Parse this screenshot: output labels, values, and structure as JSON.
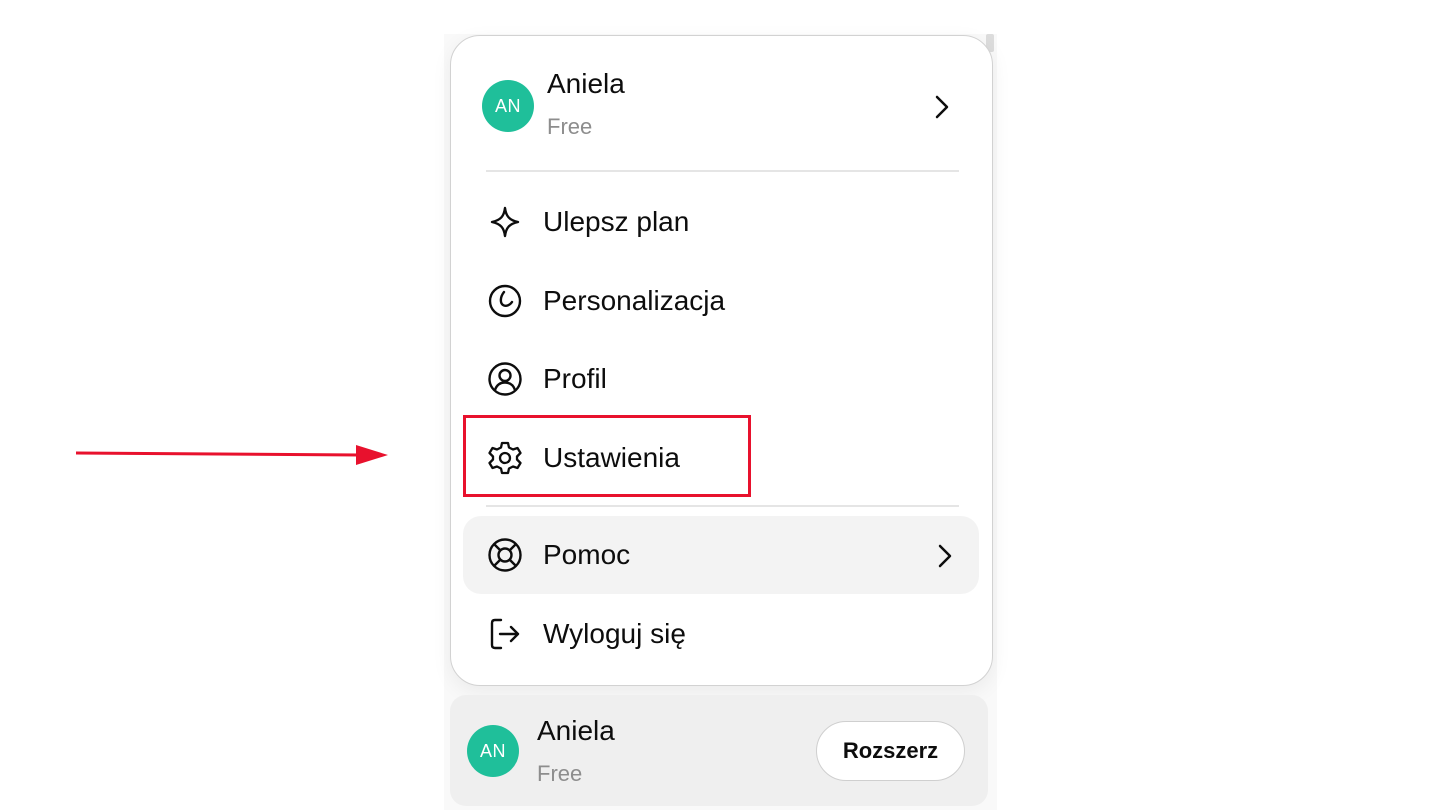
{
  "menu": {
    "user": {
      "initials": "AN",
      "name": "Aniela",
      "plan": "Free"
    },
    "items": [
      {
        "label": "Ulepsz plan",
        "icon": "sparkle-icon"
      },
      {
        "label": "Personalizacja",
        "icon": "personalize-icon"
      },
      {
        "label": "Profil",
        "icon": "profile-icon"
      },
      {
        "label": "Ustawienia",
        "icon": "gear-icon"
      }
    ],
    "help": {
      "label": "Pomoc",
      "icon": "lifebuoy-icon"
    },
    "logout": {
      "label": "Wyloguj się",
      "icon": "logout-icon"
    }
  },
  "footer": {
    "initials": "AN",
    "name": "Aniela",
    "plan": "Free",
    "button_label": "Rozszerz"
  },
  "colors": {
    "avatar": "#1fbf9a",
    "annotation": "#e8112d",
    "hover": "#f3f3f3"
  }
}
